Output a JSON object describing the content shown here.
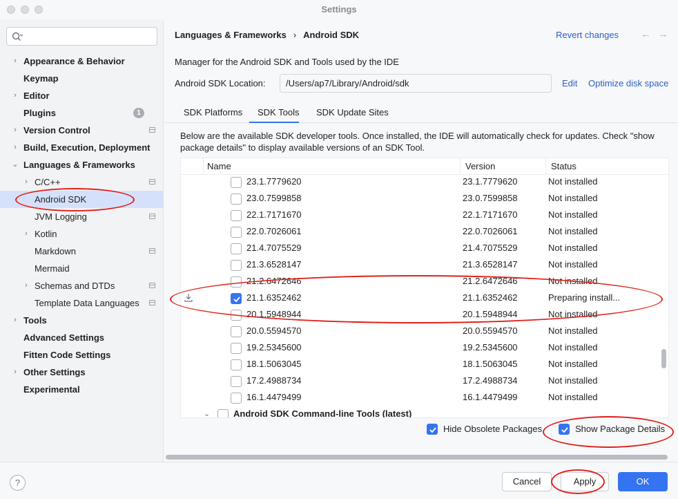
{
  "window": {
    "title": "Settings"
  },
  "sidebar": {
    "search_placeholder": "",
    "items": [
      {
        "label": "Appearance & Behavior",
        "level": 0,
        "bold": true,
        "chevron": "right"
      },
      {
        "label": "Keymap",
        "level": 0,
        "bold": true,
        "chevron": ""
      },
      {
        "label": "Editor",
        "level": 0,
        "bold": true,
        "chevron": "right"
      },
      {
        "label": "Plugins",
        "level": 0,
        "bold": true,
        "chevron": "",
        "badge": "1"
      },
      {
        "label": "Version Control",
        "level": 0,
        "bold": true,
        "chevron": "right",
        "project_icon": true
      },
      {
        "label": "Build, Execution, Deployment",
        "level": 0,
        "bold": true,
        "chevron": "right"
      },
      {
        "label": "Languages & Frameworks",
        "level": 0,
        "bold": true,
        "chevron": "down"
      },
      {
        "label": "C/C++",
        "level": 1,
        "bold": false,
        "chevron": "right",
        "project_icon": true
      },
      {
        "label": "Android SDK",
        "level": 1,
        "bold": false,
        "chevron": "",
        "selected": true
      },
      {
        "label": "JVM Logging",
        "level": 1,
        "bold": false,
        "chevron": "",
        "project_icon": true
      },
      {
        "label": "Kotlin",
        "level": 1,
        "bold": false,
        "chevron": "right"
      },
      {
        "label": "Markdown",
        "level": 1,
        "bold": false,
        "chevron": "",
        "project_icon": true
      },
      {
        "label": "Mermaid",
        "level": 1,
        "bold": false,
        "chevron": ""
      },
      {
        "label": "Schemas and DTDs",
        "level": 1,
        "bold": false,
        "chevron": "right",
        "project_icon": true
      },
      {
        "label": "Template Data Languages",
        "level": 1,
        "bold": false,
        "chevron": "",
        "project_icon": true
      },
      {
        "label": "Tools",
        "level": 0,
        "bold": true,
        "chevron": "right"
      },
      {
        "label": "Advanced Settings",
        "level": 0,
        "bold": true,
        "chevron": ""
      },
      {
        "label": "Fitten Code Settings",
        "level": 0,
        "bold": true,
        "chevron": ""
      },
      {
        "label": "Other Settings",
        "level": 0,
        "bold": true,
        "chevron": "right"
      },
      {
        "label": "Experimental",
        "level": 0,
        "bold": true,
        "chevron": ""
      }
    ]
  },
  "header": {
    "breadcrumb_parent": "Languages & Frameworks",
    "breadcrumb_separator": "›",
    "breadcrumb_current": "Android SDK",
    "revert_label": "Revert changes",
    "back_arrow": "←",
    "forward_arrow": "→"
  },
  "main": {
    "description": "Manager for the Android SDK and Tools used by the IDE",
    "location_label": "Android SDK Location:",
    "location_value": "/Users/ap7/Library/Android/sdk",
    "edit_label": "Edit",
    "optimize_label": "Optimize disk space",
    "tabs": [
      "SDK Platforms",
      "SDK Tools",
      "SDK Update Sites"
    ],
    "active_tab": "SDK Tools",
    "panel_description": "Below are the available SDK developer tools. Once installed, the IDE will automatically check for updates. Check \"show package details\" to display available versions of an SDK Tool."
  },
  "table": {
    "columns": [
      "Name",
      "Version",
      "Status"
    ],
    "rows": [
      {
        "name": "23.1.7779620",
        "version": "23.1.7779620",
        "status": "Not installed",
        "checked": false
      },
      {
        "name": "23.0.7599858",
        "version": "23.0.7599858",
        "status": "Not installed",
        "checked": false
      },
      {
        "name": "22.1.7171670",
        "version": "22.1.7171670",
        "status": "Not installed",
        "checked": false
      },
      {
        "name": "22.0.7026061",
        "version": "22.0.7026061",
        "status": "Not installed",
        "checked": false
      },
      {
        "name": "21.4.7075529",
        "version": "21.4.7075529",
        "status": "Not installed",
        "checked": false
      },
      {
        "name": "21.3.6528147",
        "version": "21.3.6528147",
        "status": "Not installed",
        "checked": false
      },
      {
        "name": "21.2.6472646",
        "version": "21.2.6472646",
        "status": "Not installed",
        "checked": false
      },
      {
        "name": "21.1.6352462",
        "version": "21.1.6352462",
        "status": "Preparing install...",
        "checked": true,
        "download_icon": true
      },
      {
        "name": "20.1.5948944",
        "version": "20.1.5948944",
        "status": "Not installed",
        "checked": false
      },
      {
        "name": "20.0.5594570",
        "version": "20.0.5594570",
        "status": "Not installed",
        "checked": false
      },
      {
        "name": "19.2.5345600",
        "version": "19.2.5345600",
        "status": "Not installed",
        "checked": false
      },
      {
        "name": "18.1.5063045",
        "version": "18.1.5063045",
        "status": "Not installed",
        "checked": false
      },
      {
        "name": "17.2.4988734",
        "version": "17.2.4988734",
        "status": "Not installed",
        "checked": false
      },
      {
        "name": "16.1.4479499",
        "version": "16.1.4479499",
        "status": "Not installed",
        "checked": false
      }
    ],
    "group_row": {
      "name": "Android SDK Command-line Tools (latest)",
      "checked": false
    }
  },
  "options": {
    "hide_obsolete_label": "Hide Obsolete Packages",
    "hide_obsolete_checked": true,
    "show_details_label": "Show Package Details",
    "show_details_checked": true
  },
  "footer": {
    "help_label": "?",
    "cancel_label": "Cancel",
    "apply_label": "Apply",
    "ok_label": "OK"
  },
  "colors": {
    "accent": "#3574f0",
    "link": "#2c5ec5",
    "annotation": "#e0211b",
    "selection": "#d5e1fa"
  }
}
